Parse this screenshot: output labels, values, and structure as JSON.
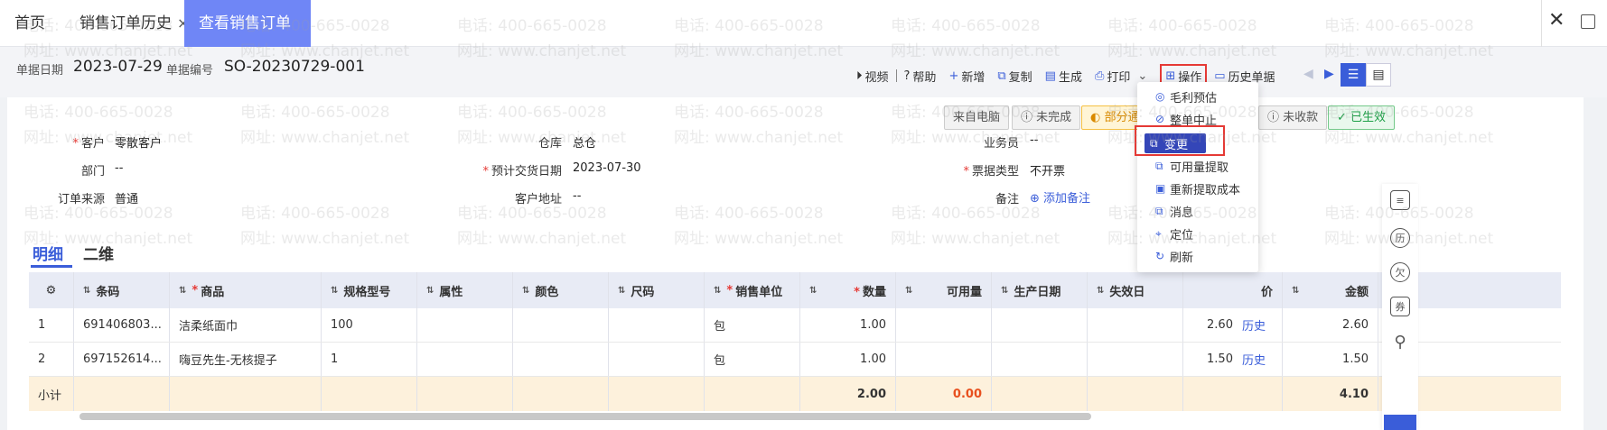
{
  "tabs": [
    {
      "label": "首页",
      "closable": false
    },
    {
      "label": "销售订单历史",
      "closable": true
    },
    {
      "label": "查看销售订单",
      "closable": true,
      "active": true
    }
  ],
  "header": {
    "date_label": "单据日期",
    "date_value": "2023-07-29",
    "number_label": "单据编号",
    "number_value": "SO-20230729-001"
  },
  "toolbar": {
    "video": "视频",
    "help": "帮助",
    "new": "新增",
    "copy": "复制",
    "generate": "生成",
    "print": "打印",
    "operate": "操作",
    "history": "历史单据"
  },
  "badges": {
    "from_pc": "来自电脑",
    "incomplete": "未完成",
    "partial": "部分通",
    "unreceived": "未收款",
    "effective": "已生效"
  },
  "form": {
    "customer_label": "客户",
    "customer_value": "零散客户",
    "warehouse_label": "仓库",
    "warehouse_value": "总仓",
    "salesman_label": "业务员",
    "salesman_value": "--",
    "dept_label": "部门",
    "dept_value": "--",
    "delivery_label": "预计交货日期",
    "delivery_value": "2023-07-30",
    "invoice_label": "票据类型",
    "invoice_value": "不开票",
    "source_label": "订单来源",
    "source_value": "普通",
    "address_label": "客户地址",
    "address_value": "--",
    "remark_label": "备注",
    "remark_add": "添加备注"
  },
  "subtabs": [
    "明细",
    "二维"
  ],
  "table": {
    "headers": [
      "条码",
      "商品",
      "规格型号",
      "属性",
      "颜色",
      "尺码",
      "销售单位",
      "数量",
      "可用量",
      "生产日期",
      "失效日",
      "价",
      "金额"
    ],
    "rows": [
      {
        "no": "1",
        "barcode": "691406803...",
        "product": "洁柔纸面巾",
        "spec": "100",
        "unit": "包",
        "qty": "1.00",
        "price": "2.60",
        "history": "历史",
        "amount": "2.60"
      },
      {
        "no": "2",
        "barcode": "697152614...",
        "product": "嗨豆先生-无核提子",
        "spec": "1",
        "unit": "包",
        "qty": "1.00",
        "price": "1.50",
        "history": "历史",
        "amount": "1.50"
      }
    ],
    "subtotal_label": "小计",
    "subtotal_qty": "2.00",
    "subtotal_available": "0.00",
    "subtotal_amount": "4.10"
  },
  "menu": {
    "items": [
      "毛利预估",
      "整单中止",
      "变更",
      "可用量提取",
      "重新提取成本",
      "消息",
      "定位",
      "刷新"
    ],
    "selected": "变更"
  },
  "watermark": {
    "phone": "电话: 400-665-0028",
    "site": "网址: www.chanjet.net"
  },
  "rail": {
    "history_icon_text": "历",
    "owe_icon_text": "欠",
    "ticket_icon_text": "券"
  },
  "colors": {
    "accent": "#3a5dd9",
    "tab_active": "#6f86f6",
    "highlight_red": "#e53935"
  }
}
